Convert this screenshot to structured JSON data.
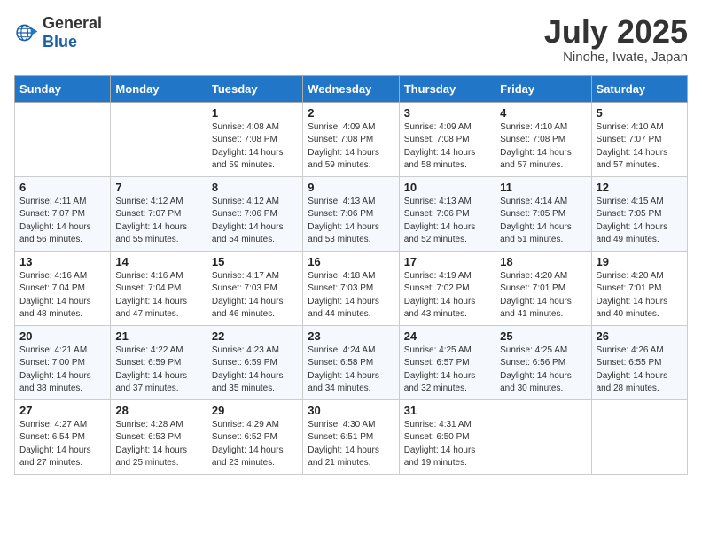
{
  "header": {
    "logo_general": "General",
    "logo_blue": "Blue",
    "month_title": "July 2025",
    "location": "Ninohe, Iwate, Japan"
  },
  "days_of_week": [
    "Sunday",
    "Monday",
    "Tuesday",
    "Wednesday",
    "Thursday",
    "Friday",
    "Saturday"
  ],
  "weeks": [
    [
      {
        "day": "",
        "info": ""
      },
      {
        "day": "",
        "info": ""
      },
      {
        "day": "1",
        "info": "Sunrise: 4:08 AM\nSunset: 7:08 PM\nDaylight: 14 hours and 59 minutes."
      },
      {
        "day": "2",
        "info": "Sunrise: 4:09 AM\nSunset: 7:08 PM\nDaylight: 14 hours and 59 minutes."
      },
      {
        "day": "3",
        "info": "Sunrise: 4:09 AM\nSunset: 7:08 PM\nDaylight: 14 hours and 58 minutes."
      },
      {
        "day": "4",
        "info": "Sunrise: 4:10 AM\nSunset: 7:08 PM\nDaylight: 14 hours and 57 minutes."
      },
      {
        "day": "5",
        "info": "Sunrise: 4:10 AM\nSunset: 7:07 PM\nDaylight: 14 hours and 57 minutes."
      }
    ],
    [
      {
        "day": "6",
        "info": "Sunrise: 4:11 AM\nSunset: 7:07 PM\nDaylight: 14 hours and 56 minutes."
      },
      {
        "day": "7",
        "info": "Sunrise: 4:12 AM\nSunset: 7:07 PM\nDaylight: 14 hours and 55 minutes."
      },
      {
        "day": "8",
        "info": "Sunrise: 4:12 AM\nSunset: 7:06 PM\nDaylight: 14 hours and 54 minutes."
      },
      {
        "day": "9",
        "info": "Sunrise: 4:13 AM\nSunset: 7:06 PM\nDaylight: 14 hours and 53 minutes."
      },
      {
        "day": "10",
        "info": "Sunrise: 4:13 AM\nSunset: 7:06 PM\nDaylight: 14 hours and 52 minutes."
      },
      {
        "day": "11",
        "info": "Sunrise: 4:14 AM\nSunset: 7:05 PM\nDaylight: 14 hours and 51 minutes."
      },
      {
        "day": "12",
        "info": "Sunrise: 4:15 AM\nSunset: 7:05 PM\nDaylight: 14 hours and 49 minutes."
      }
    ],
    [
      {
        "day": "13",
        "info": "Sunrise: 4:16 AM\nSunset: 7:04 PM\nDaylight: 14 hours and 48 minutes."
      },
      {
        "day": "14",
        "info": "Sunrise: 4:16 AM\nSunset: 7:04 PM\nDaylight: 14 hours and 47 minutes."
      },
      {
        "day": "15",
        "info": "Sunrise: 4:17 AM\nSunset: 7:03 PM\nDaylight: 14 hours and 46 minutes."
      },
      {
        "day": "16",
        "info": "Sunrise: 4:18 AM\nSunset: 7:03 PM\nDaylight: 14 hours and 44 minutes."
      },
      {
        "day": "17",
        "info": "Sunrise: 4:19 AM\nSunset: 7:02 PM\nDaylight: 14 hours and 43 minutes."
      },
      {
        "day": "18",
        "info": "Sunrise: 4:20 AM\nSunset: 7:01 PM\nDaylight: 14 hours and 41 minutes."
      },
      {
        "day": "19",
        "info": "Sunrise: 4:20 AM\nSunset: 7:01 PM\nDaylight: 14 hours and 40 minutes."
      }
    ],
    [
      {
        "day": "20",
        "info": "Sunrise: 4:21 AM\nSunset: 7:00 PM\nDaylight: 14 hours and 38 minutes."
      },
      {
        "day": "21",
        "info": "Sunrise: 4:22 AM\nSunset: 6:59 PM\nDaylight: 14 hours and 37 minutes."
      },
      {
        "day": "22",
        "info": "Sunrise: 4:23 AM\nSunset: 6:59 PM\nDaylight: 14 hours and 35 minutes."
      },
      {
        "day": "23",
        "info": "Sunrise: 4:24 AM\nSunset: 6:58 PM\nDaylight: 14 hours and 34 minutes."
      },
      {
        "day": "24",
        "info": "Sunrise: 4:25 AM\nSunset: 6:57 PM\nDaylight: 14 hours and 32 minutes."
      },
      {
        "day": "25",
        "info": "Sunrise: 4:25 AM\nSunset: 6:56 PM\nDaylight: 14 hours and 30 minutes."
      },
      {
        "day": "26",
        "info": "Sunrise: 4:26 AM\nSunset: 6:55 PM\nDaylight: 14 hours and 28 minutes."
      }
    ],
    [
      {
        "day": "27",
        "info": "Sunrise: 4:27 AM\nSunset: 6:54 PM\nDaylight: 14 hours and 27 minutes."
      },
      {
        "day": "28",
        "info": "Sunrise: 4:28 AM\nSunset: 6:53 PM\nDaylight: 14 hours and 25 minutes."
      },
      {
        "day": "29",
        "info": "Sunrise: 4:29 AM\nSunset: 6:52 PM\nDaylight: 14 hours and 23 minutes."
      },
      {
        "day": "30",
        "info": "Sunrise: 4:30 AM\nSunset: 6:51 PM\nDaylight: 14 hours and 21 minutes."
      },
      {
        "day": "31",
        "info": "Sunrise: 4:31 AM\nSunset: 6:50 PM\nDaylight: 14 hours and 19 minutes."
      },
      {
        "day": "",
        "info": ""
      },
      {
        "day": "",
        "info": ""
      }
    ]
  ]
}
